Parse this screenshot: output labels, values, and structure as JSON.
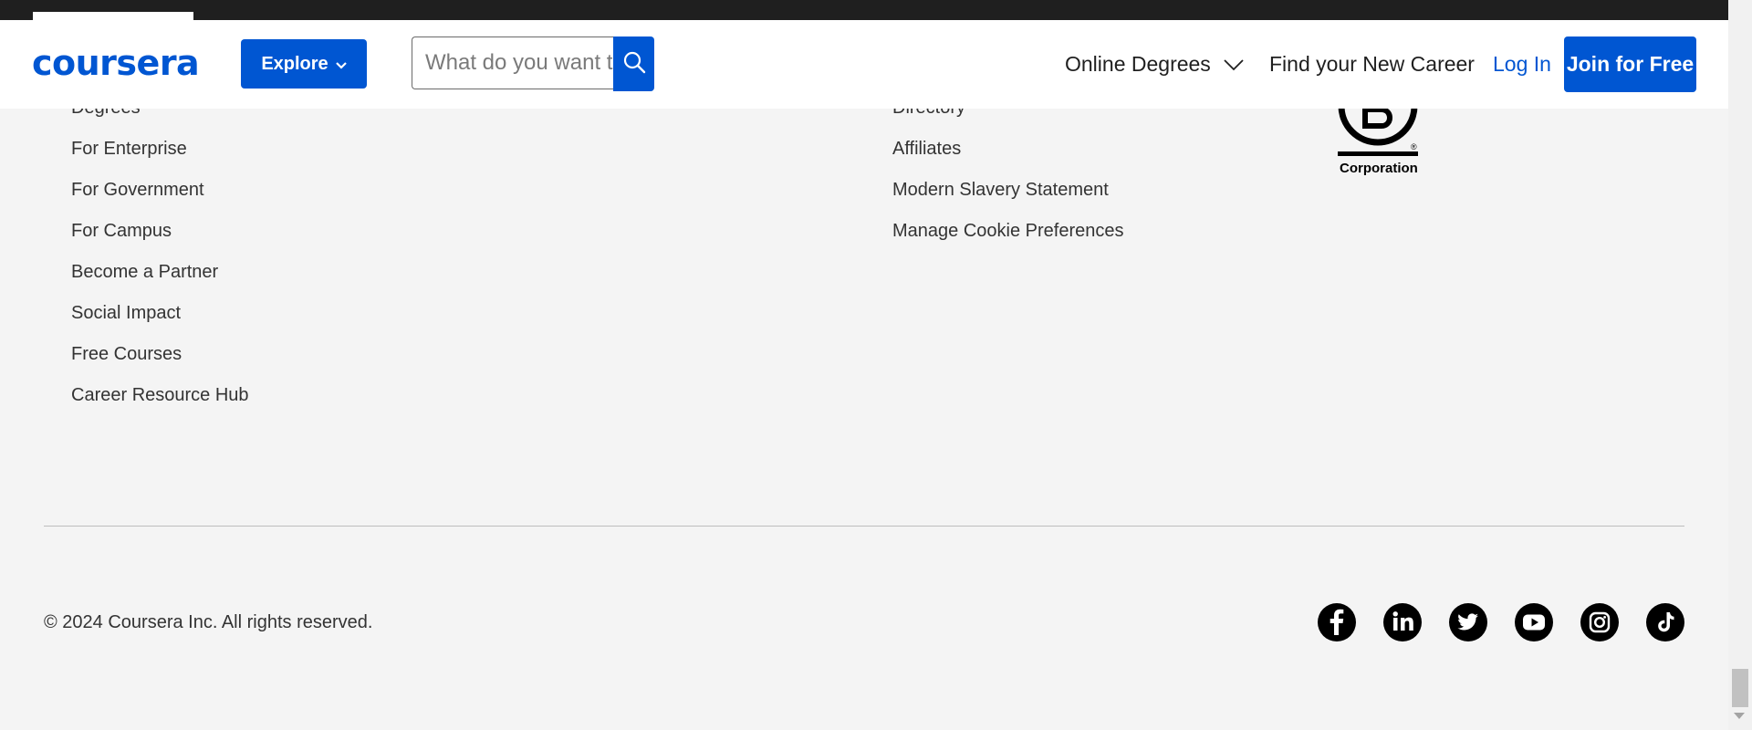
{
  "header": {
    "logo_text": "coursera",
    "explore_label": "Explore",
    "search_placeholder": "What do you want to learn?",
    "nav_online_degrees": "Online Degrees",
    "nav_find_career": "Find your New Career",
    "login_label": "Log In",
    "join_label": "Join for Free"
  },
  "footer": {
    "left_links": [
      "Degrees",
      "For Enterprise",
      "For Government",
      "For Campus",
      "Become a Partner",
      "Social Impact",
      "Free Courses",
      "Career Resource Hub"
    ],
    "middle_links": [
      "Directory",
      "Affiliates",
      "Modern Slavery Statement",
      "Manage Cookie Preferences"
    ],
    "bcorp_label": "Corporation",
    "copyright": "© 2024 Coursera Inc. All rights reserved.",
    "social_icons": [
      "facebook-icon",
      "linkedin-icon",
      "twitter-icon",
      "youtube-icon",
      "instagram-icon",
      "tiktok-icon"
    ]
  },
  "colors": {
    "brand_blue": "#0056d2",
    "footer_bg": "#f4f4f4",
    "top_strip": "#1f1f1f"
  }
}
